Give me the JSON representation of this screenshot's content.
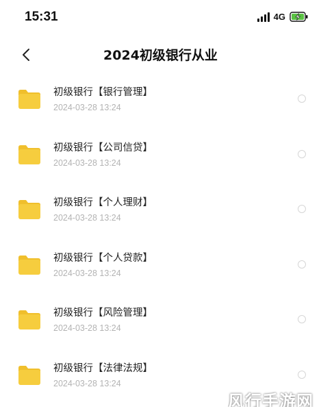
{
  "status_bar": {
    "time": "15:31",
    "network": "4G",
    "battery_color": "#5ac243"
  },
  "header": {
    "title": "2024初级银行从业",
    "back_icon": "chevron-left-icon"
  },
  "colors": {
    "folder": "#f6cd3e",
    "folder_tab": "#f0bf2c",
    "date_text": "#b3b3b3"
  },
  "files": [
    {
      "name": "初级银行【银行管理】",
      "date": "2024-03-28 13:24",
      "icon": "folder-icon"
    },
    {
      "name": "初级银行【公司信贷】",
      "date": "2024-03-28 13:24",
      "icon": "folder-icon"
    },
    {
      "name": "初级银行【个人理财】",
      "date": "2024-03-28 13:24",
      "icon": "folder-icon"
    },
    {
      "name": "初级银行【个人贷款】",
      "date": "2024-03-28 13:24",
      "icon": "folder-icon"
    },
    {
      "name": "初级银行【风险管理】",
      "date": "2024-03-28 13:24",
      "icon": "folder-icon"
    },
    {
      "name": "初级银行【法律法规】",
      "date": "2024-03-28 13:24",
      "icon": "folder-icon"
    }
  ],
  "watermark": {
    "text": "风行手游网"
  }
}
